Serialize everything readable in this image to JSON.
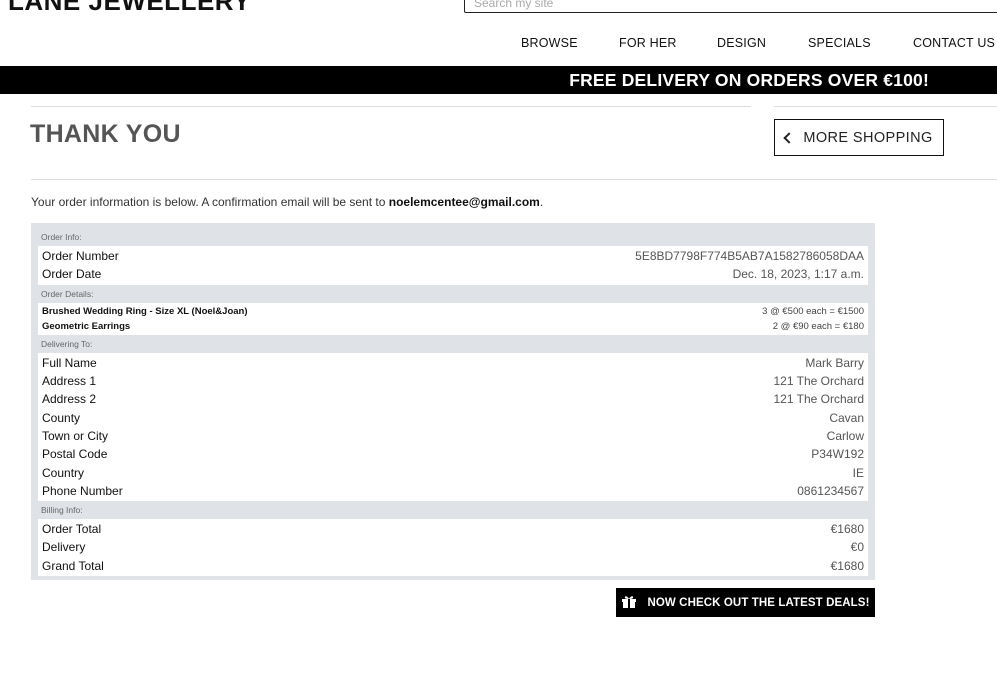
{
  "header": {
    "brand": "LANE JEWELLERY",
    "search_placeholder": "Search my site"
  },
  "nav": [
    {
      "label": "BROWSE"
    },
    {
      "label": "FOR HER"
    },
    {
      "label": "DESIGN"
    },
    {
      "label": "SPECIALS"
    },
    {
      "label": "CONTACT US"
    }
  ],
  "banner": "FREE DELIVERY ON ORDERS OVER €100!",
  "page": {
    "title": "THANK YOU",
    "more_shopping_label": "MORE SHOPPING",
    "intro_text": "Your order information is below. A confirmation email will be sent to ",
    "email": "noelemcentee@gmail.com",
    "intro_end": "."
  },
  "order": {
    "info_label": "Order Info:",
    "info": [
      {
        "label": "Order Number",
        "value": "5E8BD7798F774B5AB7A1582786058DAA"
      },
      {
        "label": "Order Date",
        "value": "Dec. 18, 2023, 1:17 a.m."
      }
    ],
    "details_label": "Order Details:",
    "details": [
      {
        "label": "Brushed Wedding Ring - Size XL (Noel&Joan)",
        "value": "3 @ €500 each = €1500"
      },
      {
        "label": "Geometric Earrings",
        "value": "2 @ €90 each = €180"
      }
    ],
    "delivering_label": "Delivering To:",
    "delivering": [
      {
        "label": "Full Name",
        "value": "Mark Barry"
      },
      {
        "label": "Address 1",
        "value": "121 The Orchard"
      },
      {
        "label": "Address 2",
        "value": "121 The Orchard"
      },
      {
        "label": "County",
        "value": "Cavan"
      },
      {
        "label": "Town or City",
        "value": "Carlow"
      },
      {
        "label": "Postal Code",
        "value": "P34W192"
      },
      {
        "label": "Country",
        "value": "IE"
      },
      {
        "label": "Phone Number",
        "value": "0861234567"
      }
    ],
    "billing_label": "Billing Info:",
    "billing": [
      {
        "label": "Order Total",
        "value": "€1680"
      },
      {
        "label": "Delivery",
        "value": "€0"
      },
      {
        "label": "Grand Total",
        "value": "€1680"
      }
    ]
  },
  "deals_button": {
    "label": "NOW CHECK OUT THE LATEST DEALS!",
    "icon": "gift-icon"
  }
}
